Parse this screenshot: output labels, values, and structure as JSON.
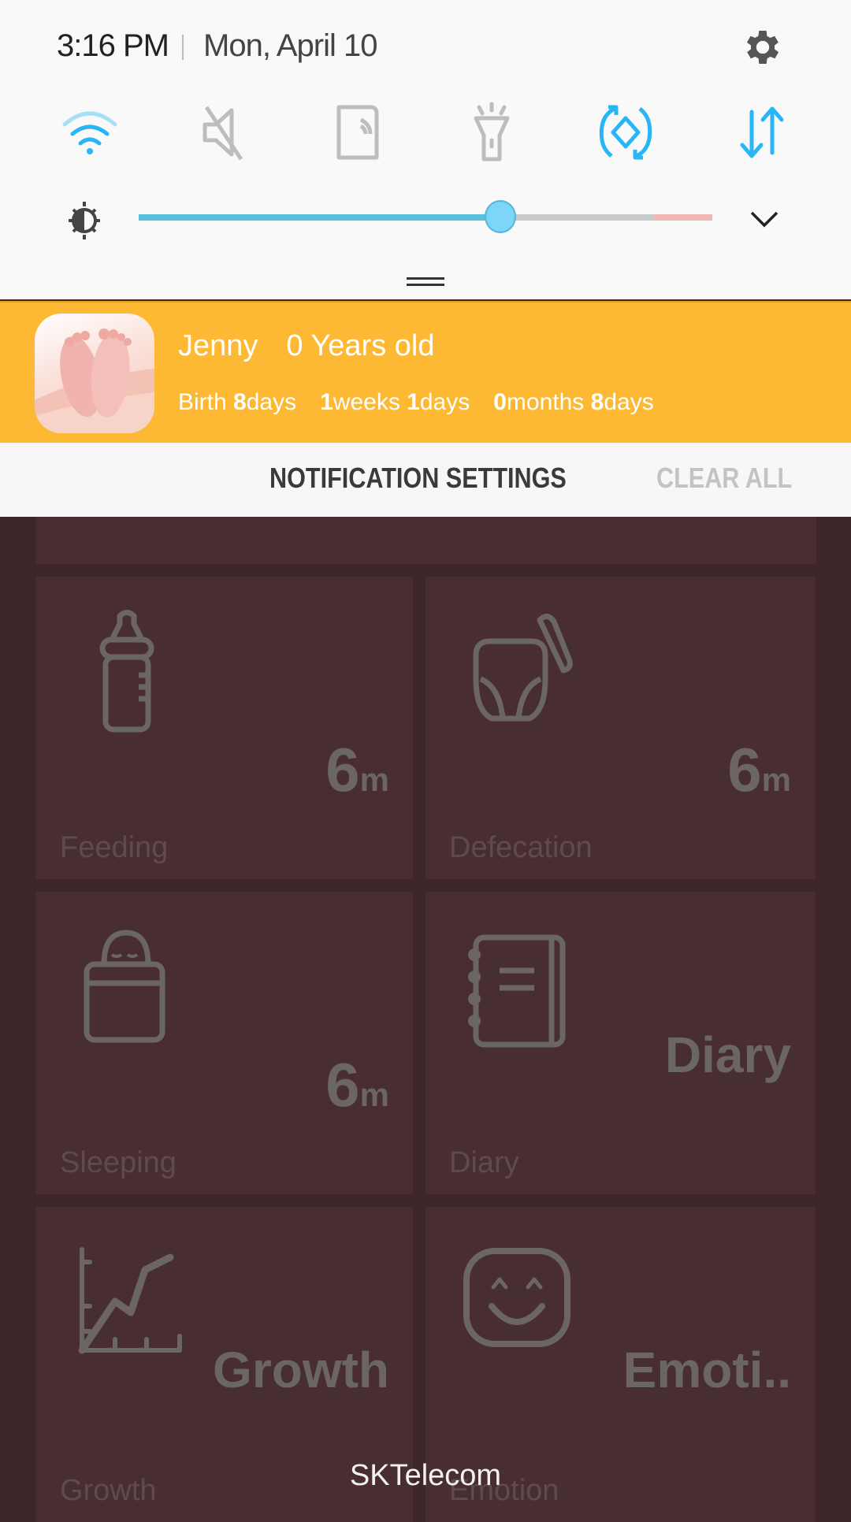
{
  "status": {
    "time": "3:16 PM",
    "date": "Mon, April 10"
  },
  "quick_settings": [
    {
      "name": "wifi",
      "icon": "wifi-icon",
      "active": true
    },
    {
      "name": "sound",
      "icon": "mute-icon",
      "active": false
    },
    {
      "name": "nfc",
      "icon": "nfc-icon",
      "active": false
    },
    {
      "name": "flashlight",
      "icon": "flashlight-icon",
      "active": false
    },
    {
      "name": "auto-rotate",
      "icon": "rotate-icon",
      "active": true
    },
    {
      "name": "mobile-data",
      "icon": "data-icon",
      "active": true
    }
  ],
  "brightness": {
    "level_percent": 63
  },
  "colors": {
    "accent": "#29b6f6",
    "notification_bg": "#fdb934",
    "inactive_icon": "#bdbdbd"
  },
  "notification": {
    "name": "Jenny",
    "age": "0 Years old",
    "birth_label": "Birth",
    "birth_days": "8",
    "days_unit": "days",
    "weeks": "1",
    "weeks_unit": "weeks",
    "weeks_days": "1",
    "months": "0",
    "months_unit": "months",
    "months_days": "8"
  },
  "actions": {
    "settings_label": "NOTIFICATION SETTINGS",
    "clear_label": "CLEAR ALL"
  },
  "tiles": [
    {
      "label": "Feeding",
      "value": "6",
      "unit": "m",
      "icon": "bottle-icon"
    },
    {
      "label": "Defecation",
      "value": "6",
      "unit": "m",
      "icon": "diaper-icon"
    },
    {
      "label": "Sleeping",
      "value": "6",
      "unit": "m",
      "icon": "sleeping-baby-icon"
    },
    {
      "label": "Diary",
      "word": "Diary",
      "icon": "notebook-icon"
    },
    {
      "label": "Growth",
      "word": "Growth",
      "icon": "growth-chart-icon"
    },
    {
      "label": "Emotion",
      "word": "Emoti..",
      "icon": "smiley-icon"
    }
  ],
  "carrier": "SKTelecom"
}
